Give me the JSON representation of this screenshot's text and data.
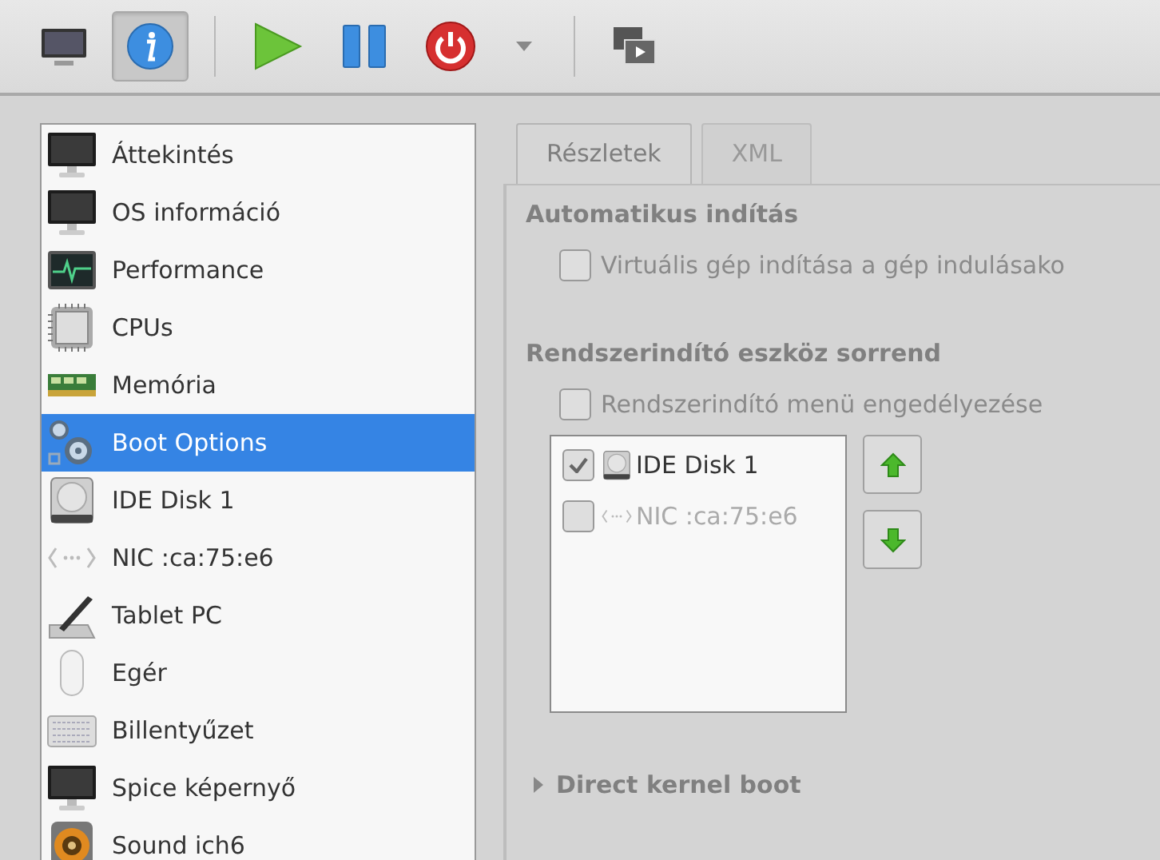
{
  "toolbar": {
    "view_toggles": [
      {
        "kind": "console",
        "selected": false
      },
      {
        "kind": "details",
        "selected": true
      }
    ],
    "actions": [
      {
        "kind": "run"
      },
      {
        "kind": "pause"
      },
      {
        "kind": "shutdown"
      },
      {
        "kind": "dropdown"
      },
      {
        "kind": "screens"
      }
    ]
  },
  "sidebar": {
    "items": [
      {
        "label": "Áttekintés",
        "kind": "monitor",
        "selected": false
      },
      {
        "label": "OS információ",
        "kind": "monitor",
        "selected": false
      },
      {
        "label": "Performance",
        "kind": "performance",
        "selected": false
      },
      {
        "label": "CPUs",
        "kind": "cpu",
        "selected": false
      },
      {
        "label": "Memória",
        "kind": "memory",
        "selected": false
      },
      {
        "label": "Boot Options",
        "kind": "boot",
        "selected": true
      },
      {
        "label": "IDE Disk 1",
        "kind": "disk",
        "selected": false
      },
      {
        "label": "NIC :ca:75:e6",
        "kind": "nic",
        "selected": false
      },
      {
        "label": "Tablet PC",
        "kind": "tablet",
        "selected": false
      },
      {
        "label": "Egér",
        "kind": "mouse",
        "selected": false
      },
      {
        "label": "Billentyűzet",
        "kind": "keyboard",
        "selected": false
      },
      {
        "label": "Spice képernyő",
        "kind": "monitor",
        "selected": false
      },
      {
        "label": "Sound ich6",
        "kind": "sound",
        "selected": false
      }
    ]
  },
  "tabs": [
    {
      "label": "Részletek",
      "selected": true
    },
    {
      "label": "XML",
      "selected": false
    }
  ],
  "autostart": {
    "heading": "Automatikus indítás",
    "checkbox": {
      "label": "Virtuális gép indítása a gép indulásako",
      "checked": false
    }
  },
  "boot_order": {
    "heading": "Rendszerindító eszköz sorrend",
    "menu_checkbox": {
      "label": "Rendszerindító menü engedélyezése",
      "checked": false
    },
    "devices": [
      {
        "label": "IDE Disk 1",
        "kind": "disk",
        "checked": true,
        "disabled": false
      },
      {
        "label": "NIC :ca:75:e6",
        "kind": "nic",
        "checked": false,
        "disabled": true
      }
    ],
    "buttons": [
      {
        "kind": "up"
      },
      {
        "kind": "down"
      }
    ]
  },
  "direct_kernel_boot": {
    "label": "Direct kernel boot",
    "expanded": false
  }
}
